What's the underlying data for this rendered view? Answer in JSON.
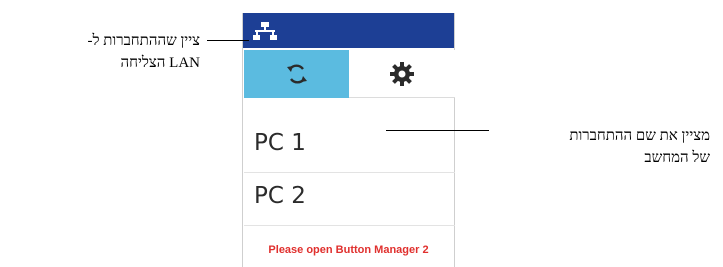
{
  "device": {
    "topbar": {
      "icon": "lan-network-icon",
      "color": "#1d3f95"
    },
    "tabs": [
      {
        "icon": "sync-icon",
        "active": true,
        "color": "#5bbbe0"
      },
      {
        "icon": "gear-icon",
        "active": false
      }
    ],
    "connections": [
      {
        "label": "PC 1"
      },
      {
        "label": "PC 2"
      }
    ],
    "warning": "Please open Button Manager 2",
    "warning_color": "#e0302e"
  },
  "callouts": {
    "lan_success": {
      "line1": "ציין שההתחברות ל-",
      "line2": "LAN הצליחה"
    },
    "connection_name": {
      "line1": "מציין את שם ההתחברות",
      "line2": "של המחשב"
    }
  }
}
